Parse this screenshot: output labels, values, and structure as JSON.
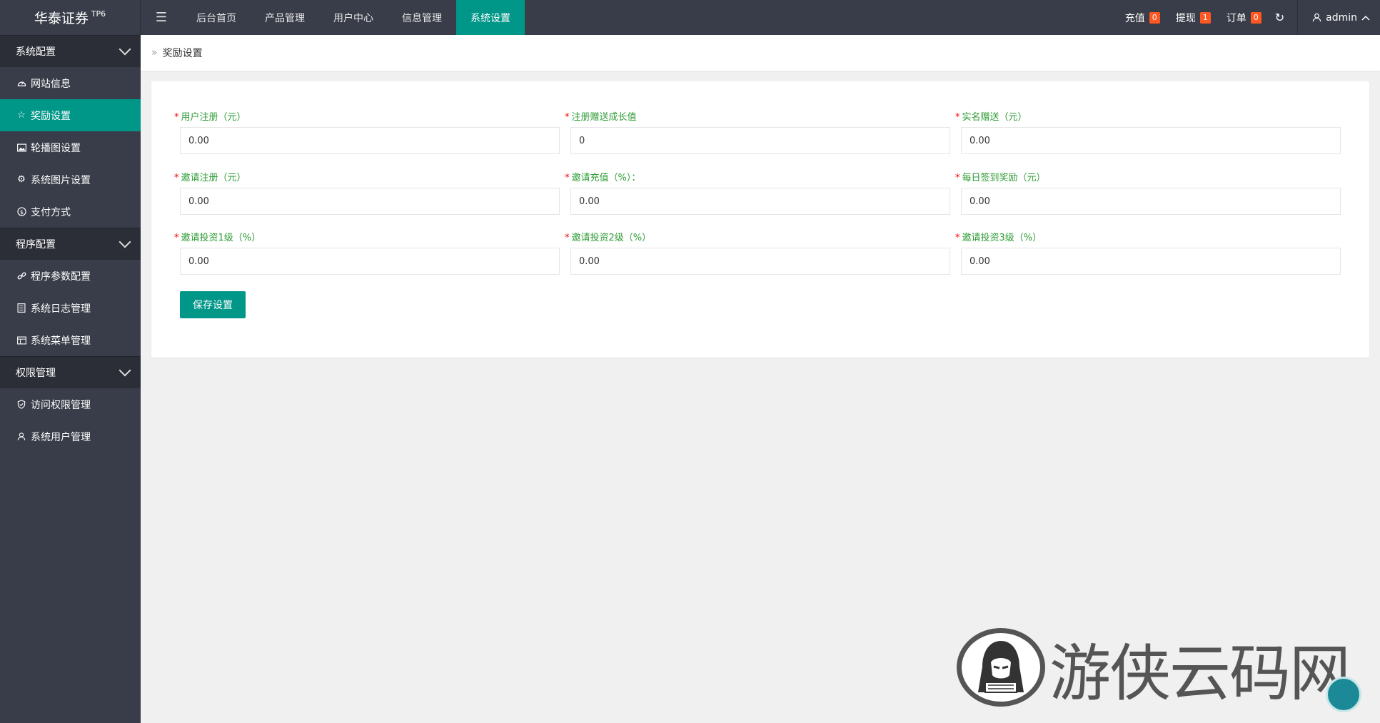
{
  "brand": {
    "name": "华泰证券",
    "suffix": "TP6"
  },
  "topnav": {
    "items": [
      "后台首页",
      "产品管理",
      "用户中心",
      "信息管理",
      "系统设置"
    ],
    "active_index": 4
  },
  "topright": {
    "recharge_label": "充值",
    "recharge_count": "0",
    "withdraw_label": "提现",
    "withdraw_count": "1",
    "order_label": "订单",
    "order_count": "0",
    "refresh_icon": "refresh-icon",
    "user_label": "admin"
  },
  "sidebar": {
    "groups": [
      {
        "label": "系统配置",
        "items": [
          {
            "label": "网站信息",
            "icon": "dashboard-icon"
          },
          {
            "label": "奖励设置",
            "icon": "star-icon"
          },
          {
            "label": "轮播图设置",
            "icon": "image-icon"
          },
          {
            "label": "系统图片设置",
            "icon": "gear-icon"
          },
          {
            "label": "支付方式",
            "icon": "dollar-icon"
          }
        ]
      },
      {
        "label": "程序配置",
        "items": [
          {
            "label": "程序参数配置",
            "icon": "link-icon"
          },
          {
            "label": "系统日志管理",
            "icon": "log-icon"
          },
          {
            "label": "系统菜单管理",
            "icon": "table-icon"
          }
        ]
      },
      {
        "label": "权限管理",
        "items": [
          {
            "label": "访问权限管理",
            "icon": "shield-icon"
          },
          {
            "label": "系统用户管理",
            "icon": "user-icon"
          }
        ]
      }
    ],
    "active_item": "奖励设置"
  },
  "breadcrumb": {
    "current": "奖励设置"
  },
  "form": {
    "fields": [
      {
        "label": "用户注册（元）",
        "value": "0.00"
      },
      {
        "label": "注册赠送成长值",
        "value": "0"
      },
      {
        "label": "实名赠送（元）",
        "value": "0.00"
      },
      {
        "label": "邀请注册（元）",
        "value": "0.00"
      },
      {
        "label": "邀请充值（%）：",
        "value": "0.00"
      },
      {
        "label": "每日签到奖励（元）",
        "value": "0.00"
      },
      {
        "label": "邀请投资1级（%）",
        "value": "0.00"
      },
      {
        "label": "邀请投资2级（%）",
        "value": "0.00"
      },
      {
        "label": "邀请投资3级（%）",
        "value": "0.00"
      }
    ],
    "save_label": "保存设置"
  },
  "watermark": {
    "text": "游侠云码网"
  },
  "colors": {
    "accent": "#009688",
    "topbar": "#393d49",
    "badge": "#ff5722",
    "label": "#2e9c35"
  }
}
